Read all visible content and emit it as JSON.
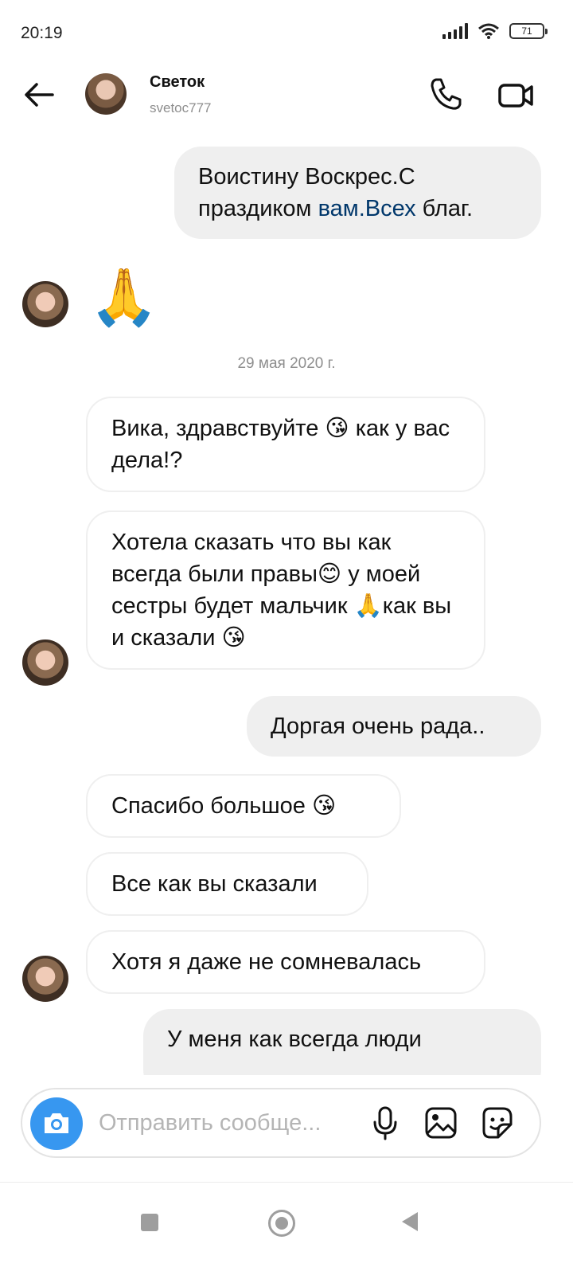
{
  "status_bar": {
    "time": "20:19",
    "battery": "71"
  },
  "header": {
    "name": "Светок",
    "username": "svetoc777",
    "back_icon": "arrow-left-icon",
    "call_icon": "phone-icon",
    "video_icon": "video-camera-icon"
  },
  "messages": [
    {
      "dir": "out",
      "text_before": "Воистину Воскрес.С праздиком ",
      "link": "вам.Всех",
      "text_after": " благ."
    },
    {
      "dir": "in",
      "text": "🙏"
    },
    {
      "dir": "in",
      "text": "Вика, здравствуйте 😘 как у вас дела!?"
    },
    {
      "dir": "in",
      "text": "Хотела сказать что вы как всегда были правы😊 у моей сестры будет мальчик 🙏как вы и сказали 😘"
    },
    {
      "dir": "out",
      "text": "Доргая очень рада.."
    },
    {
      "dir": "in",
      "text": "Спасибо большое 😘"
    },
    {
      "dir": "in",
      "text": "Все как вы сказали"
    },
    {
      "dir": "in",
      "text": "Хотя я даже не сомневалась"
    },
    {
      "dir": "out",
      "text": "У меня как всегда люди"
    }
  ],
  "date_separator": "29 мая 2020 г.",
  "composer": {
    "placeholder": "Отправить сообще...",
    "camera_icon": "camera-icon",
    "mic_icon": "microphone-icon",
    "gallery_icon": "gallery-icon",
    "sticker_icon": "sticker-icon"
  },
  "colors": {
    "accent": "#3797f0",
    "link": "#00376b",
    "outgoing_bubble": "#efefef"
  }
}
